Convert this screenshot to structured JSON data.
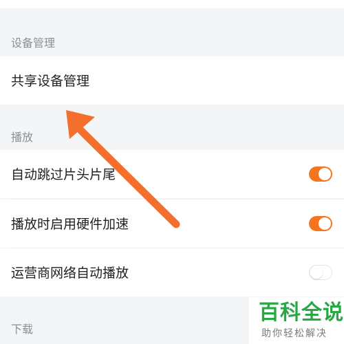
{
  "sections": {
    "device": {
      "header": "设备管理",
      "items": [
        {
          "label": "共享设备管理"
        }
      ]
    },
    "playback": {
      "header": "播放",
      "items": [
        {
          "label": "自动跳过片头片尾",
          "toggle": true
        },
        {
          "label": "播放时启用硬件加速",
          "toggle": true
        },
        {
          "label": "运营商网络自动播放",
          "toggle": false
        }
      ]
    },
    "download": {
      "header": "下载"
    }
  },
  "colors": {
    "accent": "#f5741f",
    "background": "#f4f5f6",
    "annotation_arrow": "#f36f2b",
    "watermark_green": "#27a844"
  },
  "watermark": {
    "title": "百科全说",
    "subtitle": "助你轻松解决"
  }
}
